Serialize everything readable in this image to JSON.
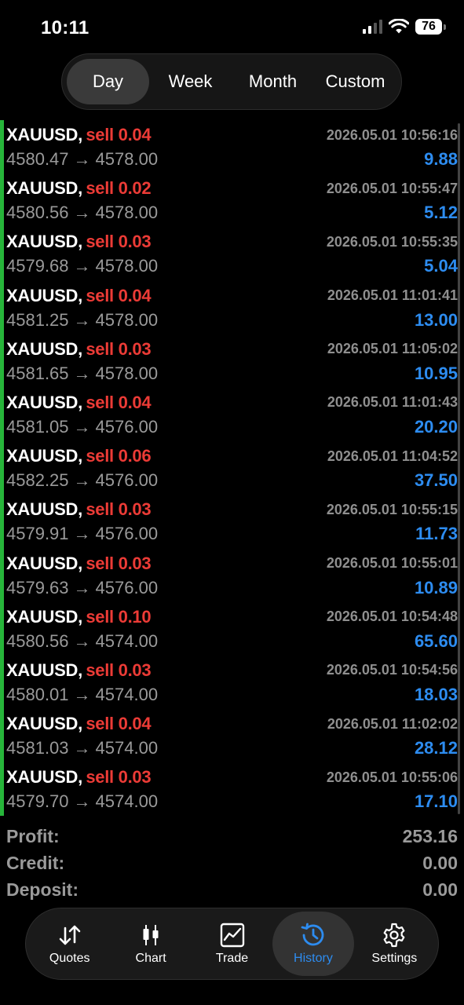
{
  "status_bar": {
    "time": "10:11",
    "battery": "76"
  },
  "period_tabs": [
    {
      "label": "Day",
      "active": true
    },
    {
      "label": "Week",
      "active": false
    },
    {
      "label": "Month",
      "active": false
    },
    {
      "label": "Custom",
      "active": false
    }
  ],
  "deals": [
    {
      "symbol": "XAUUSD,",
      "side": "sell 0.04",
      "time": "2026.05.01 10:56:16",
      "open": "4580.47",
      "close": "4578.00",
      "profit": "9.88"
    },
    {
      "symbol": "XAUUSD,",
      "side": "sell 0.02",
      "time": "2026.05.01 10:55:47",
      "open": "4580.56",
      "close": "4578.00",
      "profit": "5.12"
    },
    {
      "symbol": "XAUUSD,",
      "side": "sell 0.03",
      "time": "2026.05.01 10:55:35",
      "open": "4579.68",
      "close": "4578.00",
      "profit": "5.04"
    },
    {
      "symbol": "XAUUSD,",
      "side": "sell 0.04",
      "time": "2026.05.01 11:01:41",
      "open": "4581.25",
      "close": "4578.00",
      "profit": "13.00"
    },
    {
      "symbol": "XAUUSD,",
      "side": "sell 0.03",
      "time": "2026.05.01 11:05:02",
      "open": "4581.65",
      "close": "4578.00",
      "profit": "10.95"
    },
    {
      "symbol": "XAUUSD,",
      "side": "sell 0.04",
      "time": "2026.05.01 11:01:43",
      "open": "4581.05",
      "close": "4576.00",
      "profit": "20.20"
    },
    {
      "symbol": "XAUUSD,",
      "side": "sell 0.06",
      "time": "2026.05.01 11:04:52",
      "open": "4582.25",
      "close": "4576.00",
      "profit": "37.50"
    },
    {
      "symbol": "XAUUSD,",
      "side": "sell 0.03",
      "time": "2026.05.01 10:55:15",
      "open": "4579.91",
      "close": "4576.00",
      "profit": "11.73"
    },
    {
      "symbol": "XAUUSD,",
      "side": "sell 0.03",
      "time": "2026.05.01 10:55:01",
      "open": "4579.63",
      "close": "4576.00",
      "profit": "10.89"
    },
    {
      "symbol": "XAUUSD,",
      "side": "sell 0.10",
      "time": "2026.05.01 10:54:48",
      "open": "4580.56",
      "close": "4574.00",
      "profit": "65.60"
    },
    {
      "symbol": "XAUUSD,",
      "side": "sell 0.03",
      "time": "2026.05.01 10:54:56",
      "open": "4580.01",
      "close": "4574.00",
      "profit": "18.03"
    },
    {
      "symbol": "XAUUSD,",
      "side": "sell 0.04",
      "time": "2026.05.01 11:02:02",
      "open": "4581.03",
      "close": "4574.00",
      "profit": "28.12"
    },
    {
      "symbol": "XAUUSD,",
      "side": "sell 0.03",
      "time": "2026.05.01 10:55:06",
      "open": "4579.70",
      "close": "4574.00",
      "profit": "17.10"
    }
  ],
  "arrow": "→",
  "summary": [
    {
      "label": "Profit:",
      "value": "253.16"
    },
    {
      "label": "Credit:",
      "value": "0.00"
    },
    {
      "label": "Deposit:",
      "value": "0.00"
    }
  ],
  "tabs": [
    {
      "label": "Quotes",
      "icon": "quotes-arrows-icon",
      "active": false
    },
    {
      "label": "Chart",
      "icon": "candlestick-icon",
      "active": false
    },
    {
      "label": "Trade",
      "icon": "trade-line-chart-icon",
      "active": false
    },
    {
      "label": "History",
      "icon": "history-clock-icon",
      "active": true
    },
    {
      "label": "Settings",
      "icon": "gear-icon",
      "active": false
    }
  ],
  "colors": {
    "sell": "#ec3b36",
    "profit": "#2d8cf0",
    "accent_bar": "#27b53a",
    "active_tab": "#2d8cf0"
  }
}
